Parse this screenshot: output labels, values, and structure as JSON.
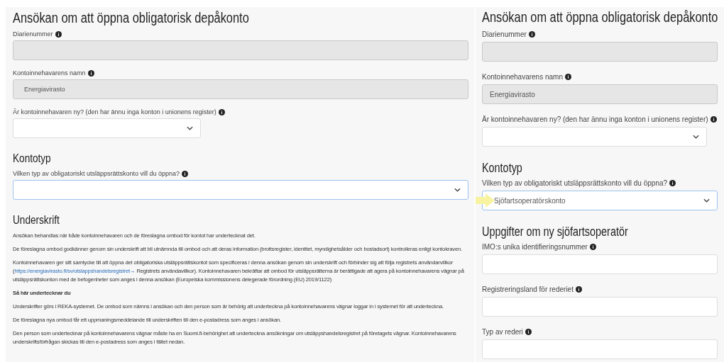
{
  "panels": [
    {
      "blocks": [
        {
          "kind": "title",
          "text": "Ansökan om att öppna obligatorisk depåkonto"
        },
        {
          "kind": "input",
          "label": "Diarienummer",
          "disabled": true
        },
        {
          "kind": "input",
          "label": "Kontoinnehavarens namn",
          "disabled": true,
          "value": "Energiavirasto"
        },
        {
          "kind": "select",
          "label": "Är kontoinnehavaren ny? (den har ännu inga konton i unionens register)",
          "compact": true
        },
        {
          "kind": "heading",
          "text": "Kontotyp"
        },
        {
          "kind": "select",
          "label": "Vilken typ av obligatoriskt utsläppsrättskonto vill du öppna?",
          "focused": true
        },
        {
          "kind": "heading",
          "text": "Underskrift"
        },
        {
          "kind": "paragraph",
          "text": "Ansökan behandlas när både kontoinnehavaren och de föreslagna ombod för kontot har undertecknat det."
        },
        {
          "kind": "paragraph",
          "text": "De föreslagna ombod godkänner genom sin underskrift att bli utnämnda till ombod och att deras information (brottsregister, identitet, myndighetsålder och bostadsort) kontrolleras enligt kontokraven."
        },
        {
          "kind": "paragraph",
          "text": "Kontoinnehavaren ger sitt samtycke till att öppna det obligatoriska utsläppsrättskontot som specificeras i denna ansökan genom sin underskrift och förbinder sig att följa registrets användarvillkor (",
          "link": "https://energiavirasto.fi/sv/utslappshandelsregistret→",
          "after": " Registrets användavillkor). Kontoinnehavaren bekräftar att ombod för utsläppsrätterna är berättigade att agera på kontoinnehavarens vägnar på utsläppsrättskonton med de befogenheter som anges i denna ansökan (Europeiska kommissionens delegerade förordning (EU) 2019/1122)"
        },
        {
          "kind": "subheading",
          "text": "Så här undertecknar du"
        },
        {
          "kind": "paragraph",
          "text": "Underskrifter görs i REKA-systemet. De ombod som nämns i ansökan och den person som är behörig att underteckna på kontoinnehavarens vägnar loggar in i systemet för att underteckna."
        },
        {
          "kind": "paragraph",
          "text": "De föreslagna nya ombod får ett uppmaningsmeddelande till underskriften till den e-postadress som anges i ansökan."
        },
        {
          "kind": "paragraph",
          "text": "Den person som undertecknar på kontoinnehavarens vägnar måste ha en Suomi.fi-behörighet att underteckna ansökningar om utsläppshandelsregistret på företagets vägnar. Kontoinnehavarens underskriftsförfrågan skickas till den e-postadress som anges i fältet nedan."
        }
      ]
    },
    {
      "blocks": [
        {
          "kind": "title",
          "text": "Ansökan om att öppna obligatorisk depåkonto"
        },
        {
          "kind": "input",
          "label": "Diarienummer",
          "disabled": true
        },
        {
          "kind": "input",
          "label": "Kontoinnehavarens namn",
          "disabled": true,
          "value": "Energiavirasto"
        },
        {
          "kind": "select",
          "label": "Är kontoinnehavaren ny? (den har ännu inga konton i unionens register)",
          "compact": true
        },
        {
          "kind": "heading",
          "text": "Kontotyp"
        },
        {
          "kind": "select",
          "label": "Vilken typ av obligatoriskt utsläppsrättskonto vill du öppna?",
          "focused": true,
          "value": "Sjöfartsoperatörskonto",
          "pointer": true
        },
        {
          "kind": "heading",
          "text": "Uppgifter om ny sjöfartsoperatör"
        },
        {
          "kind": "input",
          "label": "IMO:s unika identifieringsnummer",
          "disabled": false
        },
        {
          "kind": "input",
          "label": "Registreringsland för rederiet",
          "disabled": false
        },
        {
          "kind": "input",
          "label": "Typ av rederi",
          "disabled": false
        }
      ]
    }
  ]
}
